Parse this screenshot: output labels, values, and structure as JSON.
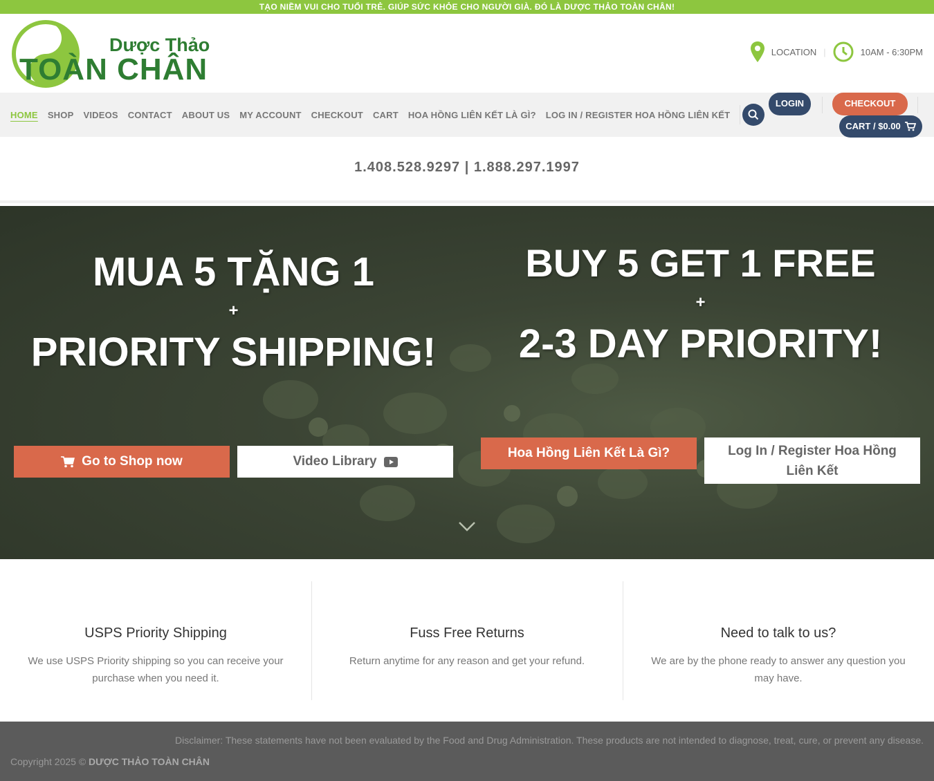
{
  "topbar": {
    "text": "TẠO NIỀM VUI CHO TUỔI TRẺ. GIÚP SỨC KHỎE CHO NGƯỜI GIÀ. ĐÓ LÀ DƯỢC THẢO TOÀN CHÂN!"
  },
  "logo": {
    "line1": "Dược Thảo",
    "line2": "TOÀN CHÂN"
  },
  "header": {
    "location": "LOCATION",
    "hours": "10AM - 6:30PM"
  },
  "nav": {
    "items": [
      "HOME",
      "SHOP",
      "VIDEOS",
      "CONTACT",
      "ABOUT US",
      "MY ACCOUNT",
      "CHECKOUT",
      "CART",
      "HOA HỒNG LIÊN KẾT LÀ GÌ?",
      "LOG IN / REGISTER HOA HỒNG LIÊN KẾT"
    ],
    "login": "LOGIN",
    "checkout": "CHECKOUT",
    "cart": "CART / $0.00"
  },
  "phones": "1.408.528.9297  |  1.888.297.1997",
  "hero": {
    "left": {
      "line1": "MUA 5 TẶNG 1",
      "plus": "+",
      "line2": "PRIORITY SHIPPING!"
    },
    "right": {
      "line1": "BUY 5 GET 1 FREE",
      "plus": "+",
      "line2": "2-3 DAY PRIORITY!"
    },
    "buttons": {
      "shop": "Go to Shop now",
      "video": "Video Library",
      "affiliate": "Hoa Hồng Liên Kết Là Gì?",
      "register": "Log In / Register Hoa Hồng Liên Kết"
    }
  },
  "features": [
    {
      "title": "USPS Priority Shipping",
      "text": "We use USPS Priority shipping so you can receive your purchase when you need it."
    },
    {
      "title": "Fuss Free Returns",
      "text": "Return anytime for any reason and get your refund."
    },
    {
      "title": "Need to talk to us?",
      "text": "We are by the phone ready to answer any question you may have."
    }
  ],
  "footer": {
    "disclaimer": "Disclaimer: These statements have not been evaluated by the Food and Drug Administration. These products are not intended to diagnose, treat, cure, or prevent any disease.",
    "copyright_prefix": "Copyright 2025 ©",
    "brand": "DƯỢC THẢO TOÀN CHÂN"
  },
  "colors": {
    "brand_green": "#8dc63f",
    "dark_green": "#2e7d32",
    "accent_orange": "#d9694b",
    "navy": "#344a6b"
  }
}
